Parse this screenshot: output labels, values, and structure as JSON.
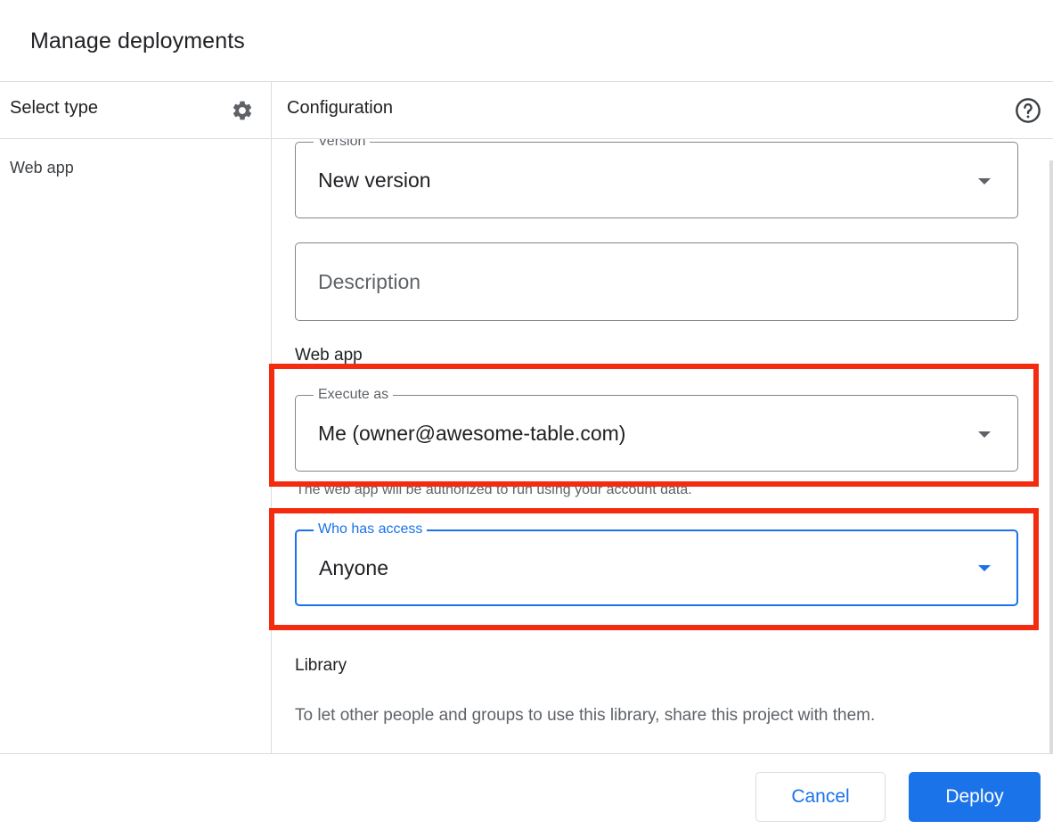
{
  "dialog": {
    "title": "Manage deployments"
  },
  "left_panel": {
    "header": "Select type",
    "gear_icon": "gear-icon",
    "items": [
      {
        "label": "Web app"
      }
    ]
  },
  "right_panel": {
    "header": "Configuration",
    "help_icon": "help-circle-icon",
    "version": {
      "label": "Version",
      "value": "New version"
    },
    "description": {
      "placeholder": "Description"
    },
    "web_app": {
      "section_title": "Web app",
      "execute_as": {
        "label": "Execute as",
        "value": "Me (owner@awesome-table.com)",
        "helper": "The web app will be authorized to run using your account data."
      },
      "who_has_access": {
        "label": "Who has access",
        "value": "Anyone"
      }
    },
    "library": {
      "section_title": "Library",
      "text": "To let other people and groups to use this library, share this project with them."
    }
  },
  "footer": {
    "cancel_label": "Cancel",
    "deploy_label": "Deploy"
  },
  "colors": {
    "accent": "#1a73e8",
    "highlight": "#f52b10",
    "divider": "#dadce0"
  }
}
